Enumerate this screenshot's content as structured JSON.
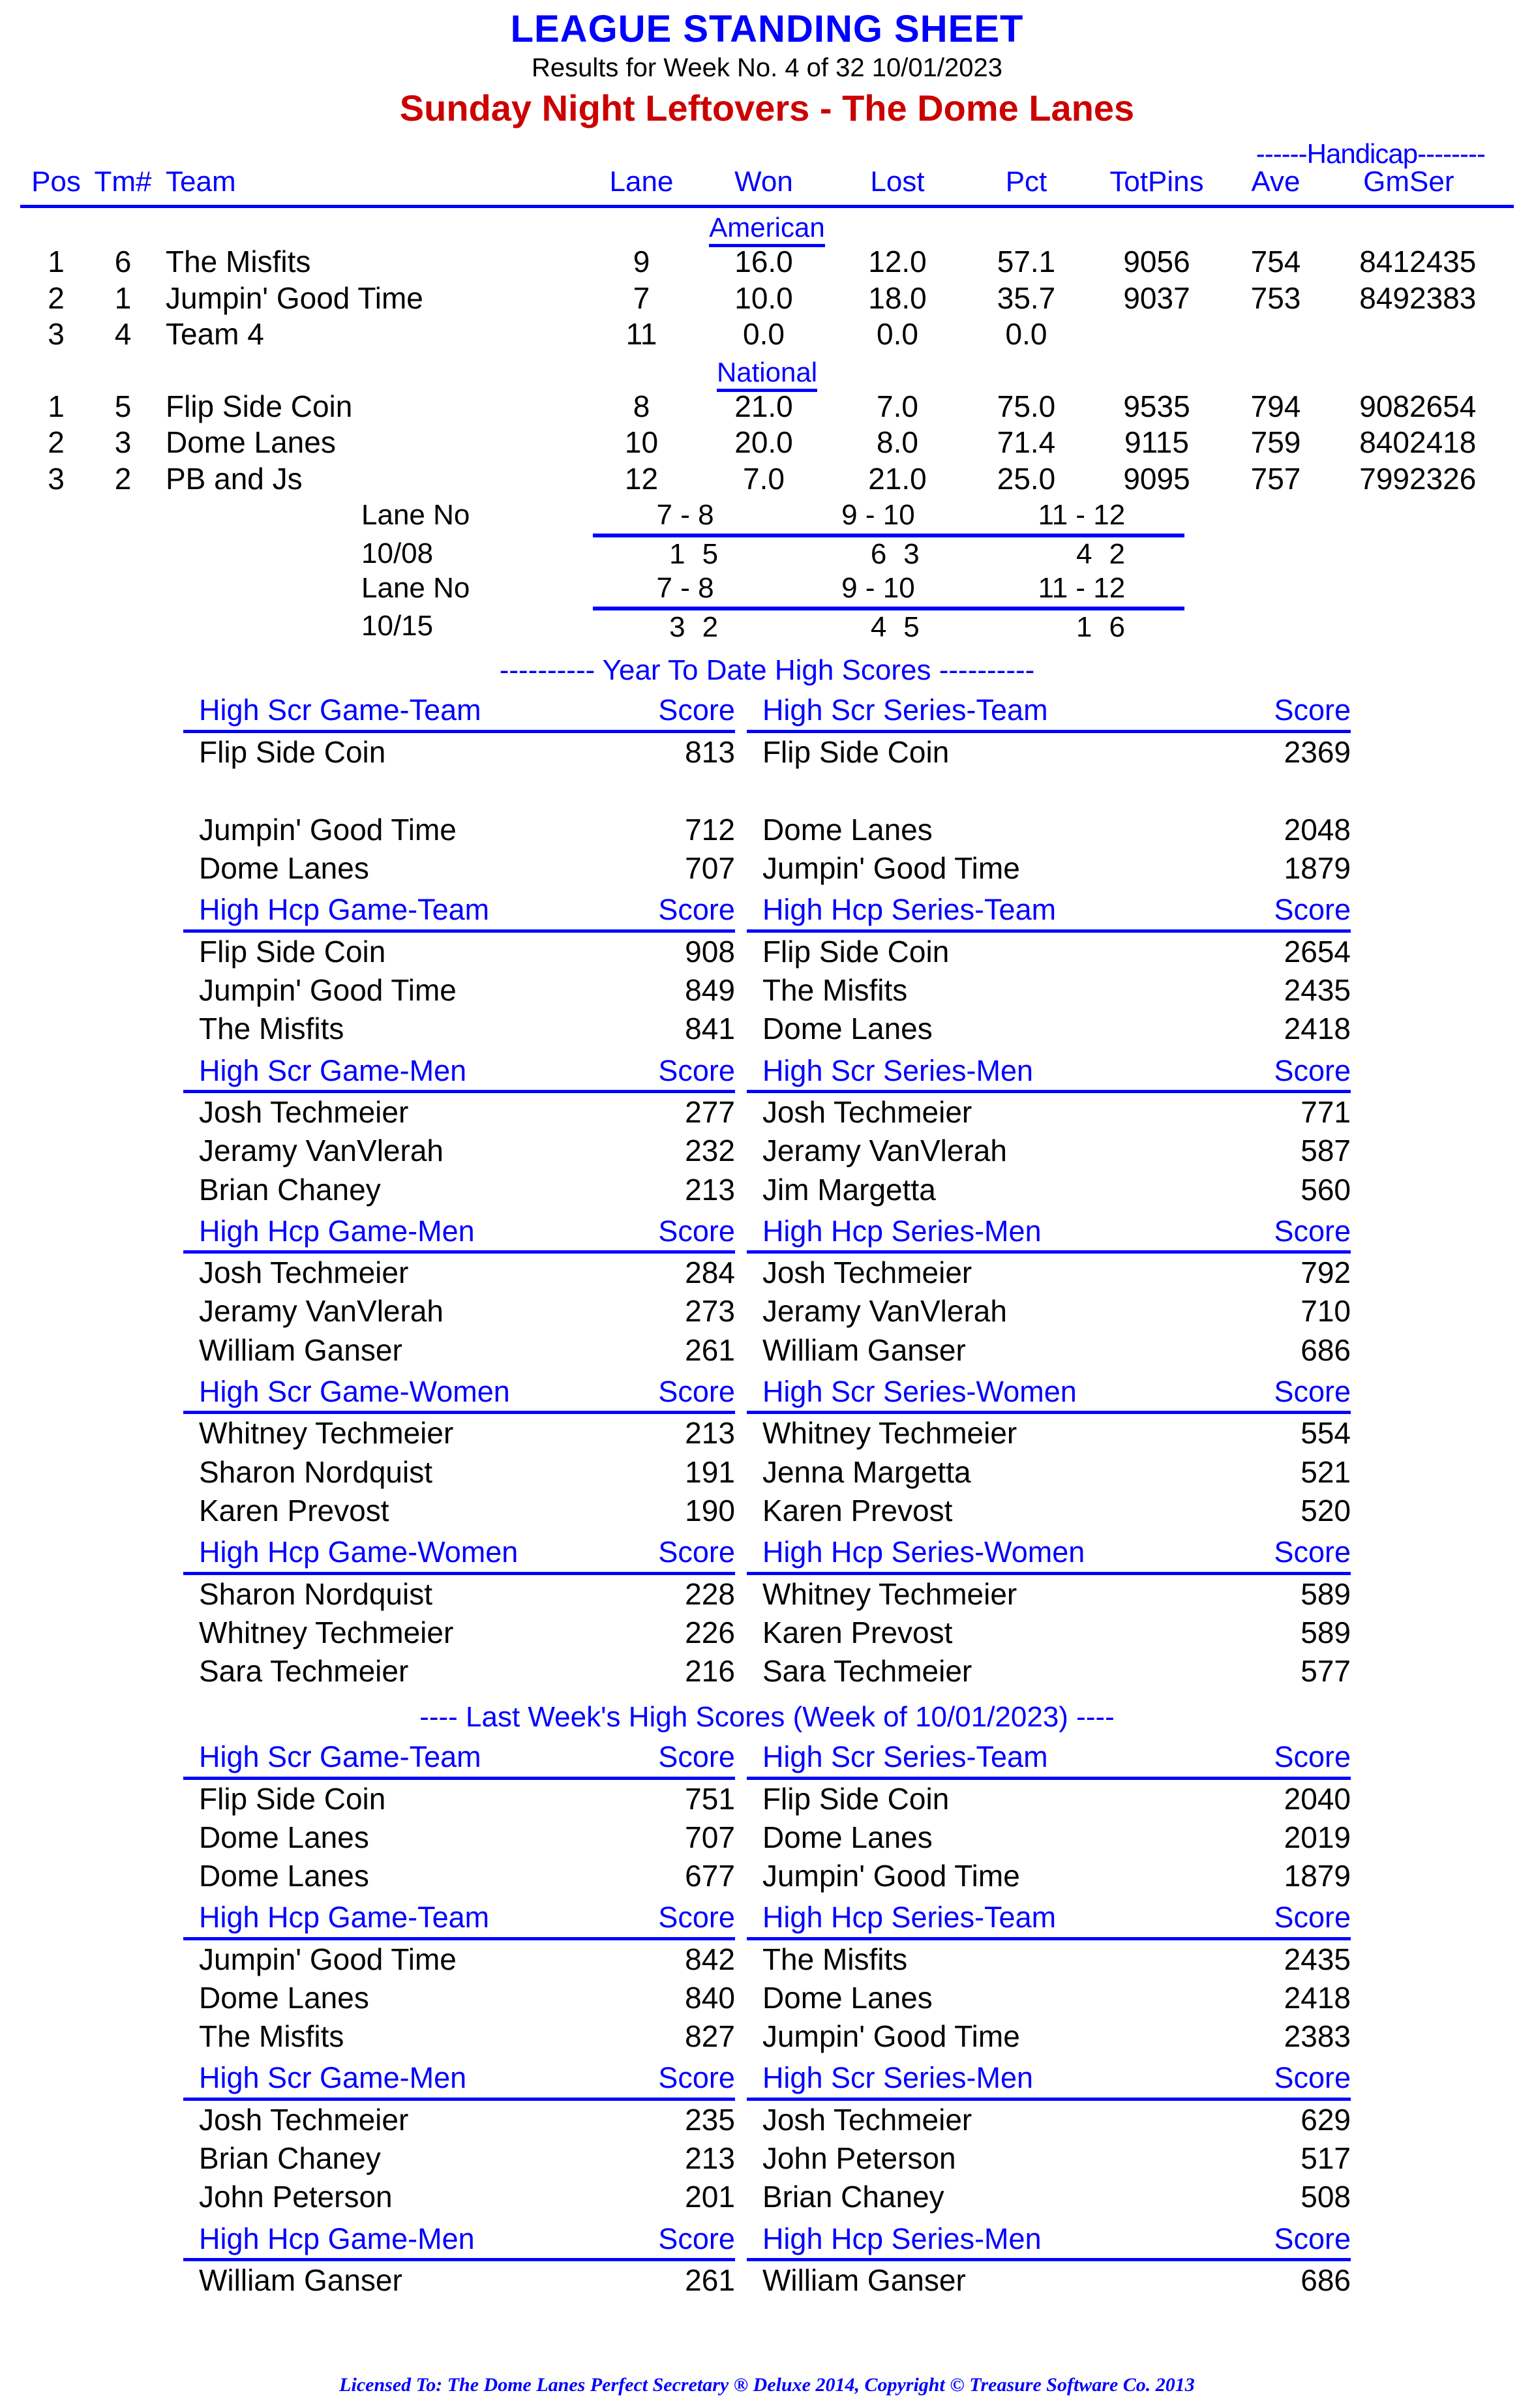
{
  "header": {
    "title": "LEAGUE STANDING SHEET",
    "subtitle": "Results for Week No. 4 of 32    10/01/2023",
    "league": "Sunday Night Leftovers - The Dome Lanes"
  },
  "standings": {
    "handicap_label": "------Handicap--------",
    "columns": {
      "pos": "Pos",
      "tm": "Tm#",
      "team": "Team",
      "lane": "Lane",
      "won": "Won",
      "lost": "Lost",
      "pct": "Pct",
      "totpins": "TotPins",
      "ave": "Ave",
      "gm": "Gm",
      "ser": "Ser"
    },
    "divisions": [
      {
        "name": "American",
        "rows": [
          {
            "pos": "1",
            "tm": "6",
            "team": "The Misfits",
            "lane": "9",
            "won": "16.0",
            "lost": "12.0",
            "pct": "57.1",
            "totpins": "9056",
            "ave": "754",
            "gm": "841",
            "ser": "2435"
          },
          {
            "pos": "2",
            "tm": "1",
            "team": "Jumpin' Good Time",
            "lane": "7",
            "won": "10.0",
            "lost": "18.0",
            "pct": "35.7",
            "totpins": "9037",
            "ave": "753",
            "gm": "849",
            "ser": "2383"
          },
          {
            "pos": "3",
            "tm": "4",
            "team": "Team 4",
            "lane": "11",
            "won": "0.0",
            "lost": "0.0",
            "pct": "0.0",
            "totpins": "",
            "ave": "",
            "gm": "",
            "ser": ""
          }
        ]
      },
      {
        "name": "National",
        "rows": [
          {
            "pos": "1",
            "tm": "5",
            "team": "Flip Side Coin",
            "lane": "8",
            "won": "21.0",
            "lost": "7.0",
            "pct": "75.0",
            "totpins": "9535",
            "ave": "794",
            "gm": "908",
            "ser": "2654"
          },
          {
            "pos": "2",
            "tm": "3",
            "team": "Dome Lanes",
            "lane": "10",
            "won": "20.0",
            "lost": "8.0",
            "pct": "71.4",
            "totpins": "9115",
            "ave": "759",
            "gm": "840",
            "ser": "2418"
          },
          {
            "pos": "3",
            "tm": "2",
            "team": "PB and Js",
            "lane": "12",
            "won": "7.0",
            "lost": "21.0",
            "pct": "25.0",
            "totpins": "9095",
            "ave": "757",
            "gm": "799",
            "ser": "2326"
          }
        ]
      }
    ]
  },
  "lane_schedule": {
    "label": "Lane No",
    "pairs": [
      "7 - 8",
      "9 - 10",
      "11 - 12"
    ],
    "weeks": [
      {
        "date": "10/08",
        "teams": [
          "1",
          "5",
          "6",
          "3",
          "4",
          "2"
        ]
      },
      {
        "date": "10/15",
        "teams": [
          "3",
          "2",
          "4",
          "5",
          "1",
          "6"
        ]
      }
    ]
  },
  "ytd": {
    "banner": "---------- Year To Date High Scores ----------",
    "blocks": [
      {
        "left_head": "High Scr Game-Team",
        "left_score_head": "Score",
        "right_head": "High Scr Series-Team",
        "right_score_head": "Score",
        "rows": [
          {
            "ln": "Flip Side Coin",
            "ls": "813",
            "rn": "Flip Side Coin",
            "rs": "2369"
          },
          {
            "ln": "",
            "ls": "",
            "rn": "",
            "rs": ""
          },
          {
            "ln": "Jumpin' Good Time",
            "ls": "712",
            "rn": "Dome Lanes",
            "rs": "2048"
          },
          {
            "ln": "Dome Lanes",
            "ls": "707",
            "rn": "Jumpin' Good Time",
            "rs": "1879"
          }
        ]
      },
      {
        "left_head": "High Hcp Game-Team",
        "left_score_head": "Score",
        "right_head": "High Hcp Series-Team",
        "right_score_head": "Score",
        "rows": [
          {
            "ln": "Flip Side Coin",
            "ls": "908",
            "rn": "Flip Side Coin",
            "rs": "2654"
          },
          {
            "ln": "Jumpin' Good Time",
            "ls": "849",
            "rn": "The Misfits",
            "rs": "2435"
          },
          {
            "ln": "The Misfits",
            "ls": "841",
            "rn": "Dome Lanes",
            "rs": "2418"
          }
        ]
      },
      {
        "left_head": "High Scr Game-Men",
        "left_score_head": "Score",
        "right_head": "High Scr Series-Men",
        "right_score_head": "Score",
        "rows": [
          {
            "ln": "Josh Techmeier",
            "ls": "277",
            "rn": "Josh Techmeier",
            "rs": "771"
          },
          {
            "ln": "Jeramy VanVlerah",
            "ls": "232",
            "rn": "Jeramy VanVlerah",
            "rs": "587"
          },
          {
            "ln": "Brian Chaney",
            "ls": "213",
            "rn": "Jim Margetta",
            "rs": "560"
          }
        ]
      },
      {
        "left_head": "High Hcp Game-Men",
        "left_score_head": "Score",
        "right_head": "High Hcp Series-Men",
        "right_score_head": "Score",
        "rows": [
          {
            "ln": "Josh Techmeier",
            "ls": "284",
            "rn": "Josh Techmeier",
            "rs": "792"
          },
          {
            "ln": "Jeramy VanVlerah",
            "ls": "273",
            "rn": "Jeramy VanVlerah",
            "rs": "710"
          },
          {
            "ln": "William Ganser",
            "ls": "261",
            "rn": "William Ganser",
            "rs": "686"
          }
        ]
      },
      {
        "left_head": "High Scr Game-Women",
        "left_score_head": "Score",
        "right_head": "High Scr Series-Women",
        "right_score_head": "Score",
        "rows": [
          {
            "ln": "Whitney Techmeier",
            "ls": "213",
            "rn": "Whitney Techmeier",
            "rs": "554"
          },
          {
            "ln": "Sharon Nordquist",
            "ls": "191",
            "rn": "Jenna Margetta",
            "rs": "521"
          },
          {
            "ln": "Karen Prevost",
            "ls": "190",
            "rn": "Karen Prevost",
            "rs": "520"
          }
        ]
      },
      {
        "left_head": "High Hcp Game-Women",
        "left_score_head": "Score",
        "right_head": "High Hcp Series-Women",
        "right_score_head": "Score",
        "rows": [
          {
            "ln": "Sharon Nordquist",
            "ls": "228",
            "rn": "Whitney Techmeier",
            "rs": "589"
          },
          {
            "ln": "Whitney Techmeier",
            "ls": "226",
            "rn": "Karen Prevost",
            "rs": "589"
          },
          {
            "ln": "Sara Techmeier",
            "ls": "216",
            "rn": "Sara Techmeier",
            "rs": "577"
          }
        ]
      }
    ]
  },
  "last_week": {
    "banner": "----  Last Week's High Scores   (Week of 10/01/2023)  ----",
    "blocks": [
      {
        "left_head": "High Scr Game-Team",
        "left_score_head": "Score",
        "right_head": "High Scr Series-Team",
        "right_score_head": "Score",
        "rows": [
          {
            "ln": "Flip Side Coin",
            "ls": "751",
            "rn": "Flip Side Coin",
            "rs": "2040"
          },
          {
            "ln": "Dome Lanes",
            "ls": "707",
            "rn": "Dome Lanes",
            "rs": "2019"
          },
          {
            "ln": "Dome Lanes",
            "ls": "677",
            "rn": "Jumpin' Good Time",
            "rs": "1879"
          }
        ]
      },
      {
        "left_head": "High Hcp Game-Team",
        "left_score_head": "Score",
        "right_head": "High Hcp Series-Team",
        "right_score_head": "Score",
        "rows": [
          {
            "ln": "Jumpin' Good Time",
            "ls": "842",
            "rn": "The Misfits",
            "rs": "2435"
          },
          {
            "ln": "Dome Lanes",
            "ls": "840",
            "rn": "Dome Lanes",
            "rs": "2418"
          },
          {
            "ln": "The Misfits",
            "ls": "827",
            "rn": "Jumpin' Good Time",
            "rs": "2383"
          }
        ]
      },
      {
        "left_head": "High Scr Game-Men",
        "left_score_head": "Score",
        "right_head": "High Scr Series-Men",
        "right_score_head": "Score",
        "rows": [
          {
            "ln": "Josh Techmeier",
            "ls": "235",
            "rn": "Josh Techmeier",
            "rs": "629"
          },
          {
            "ln": "Brian Chaney",
            "ls": "213",
            "rn": "John Peterson",
            "rs": "517"
          },
          {
            "ln": "John Peterson",
            "ls": "201",
            "rn": "Brian Chaney",
            "rs": "508"
          }
        ]
      },
      {
        "left_head": "High Hcp Game-Men",
        "left_score_head": "Score",
        "right_head": "High Hcp Series-Men",
        "right_score_head": "Score",
        "rows": [
          {
            "ln": "William Ganser",
            "ls": "261",
            "rn": "William Ganser",
            "rs": "686"
          }
        ]
      }
    ]
  },
  "footer": {
    "text": "Licensed To: The Dome Lanes    Perfect Secretary ® Deluxe  2014, Copyright © Treasure Software Co. 2013"
  },
  "colors": {
    "accent_blue": "#0000ff",
    "league_red": "#cc0000",
    "text_black": "#000000",
    "background": "#ffffff"
  }
}
